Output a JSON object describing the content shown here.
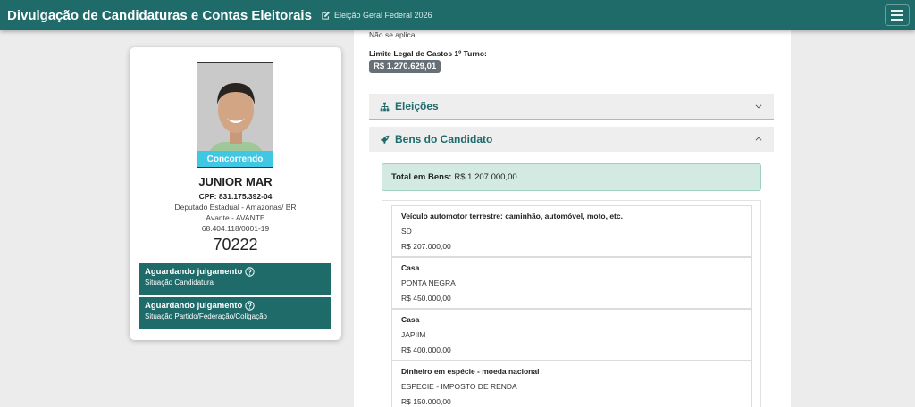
{
  "header": {
    "title": "Divulgação de Candidaturas e Contas Eleitorais",
    "election": "Eleição Geral Federal 2026"
  },
  "candidate": {
    "photo_status": "Concorrendo",
    "name": "JUNIOR MAR",
    "cpf": "CPF: 831.175.392-04",
    "office": "Deputado Estadual - Amazonas/ BR",
    "party": "Avante - AVANTE",
    "cnpj": "68.404.118/0001-19",
    "number": "70222",
    "statuses": [
      {
        "title": "Aguardando julgamento",
        "subtitle": "Situação Candidatura"
      },
      {
        "title": "Aguardando julgamento",
        "subtitle": "Situação Partido/Federação/Coligação"
      }
    ]
  },
  "details": {
    "not_applicable": "Não se aplica",
    "spending_limit_label": "Limite Legal de Gastos 1º Turno:",
    "spending_limit_value": "R$ 1.270.629,01"
  },
  "sections": {
    "elections_label": "Eleições",
    "assets_label": "Bens do Candidato"
  },
  "assets": {
    "total_label": "Total em Bens:",
    "total_value": "R$ 1.207.000,00",
    "items": [
      {
        "description": "Veículo automotor terrestre: caminhão, automóvel, moto, etc.",
        "detail": "SD",
        "value": "R$ 207.000,00"
      },
      {
        "description": "Casa",
        "detail": "PONTA NEGRA",
        "value": "R$ 450.000,00"
      },
      {
        "description": "Casa",
        "detail": "JAPIIM",
        "value": "R$ 400.000,00"
      },
      {
        "description": "Dinheiro em espécie - moeda nacional",
        "detail": "ESPECIE - IMPOSTO DE RENDA",
        "value": "R$ 150.000,00"
      }
    ]
  },
  "colors": {
    "brand": "#1e6b6a",
    "badge": "#3fc7e3",
    "total_bg": "#d2eae2"
  },
  "icons": [
    "edit-icon",
    "menu-icon",
    "help-circle-icon",
    "sitemap-icon",
    "rocket-icon",
    "chevron-down-icon",
    "chevron-up-icon"
  ]
}
